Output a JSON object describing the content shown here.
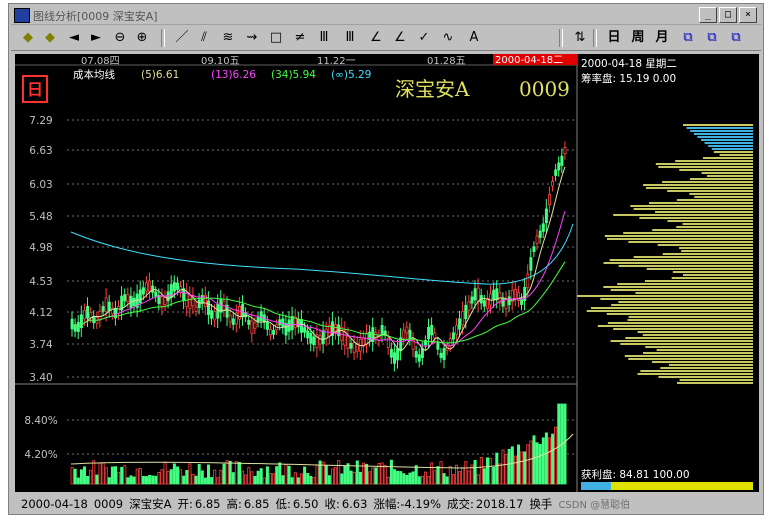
{
  "window": {
    "title": "图线分析[0009 深宝安A]",
    "controls": {
      "minimize": "_",
      "maximize": "□",
      "close": "×"
    }
  },
  "toolbar": {
    "left_tools": [
      "◆",
      "◆",
      "◄",
      "►",
      "⊖",
      "⊕"
    ],
    "draw_tools": [
      "／",
      "⫽",
      "≋",
      "⇝",
      "□",
      "≠",
      "Ⅲ",
      "Ⅲ",
      "∠",
      "∠",
      "✓",
      "∿",
      "A"
    ],
    "period_tools": [
      "日",
      "周",
      "月"
    ]
  },
  "chart_header": {
    "period_badge": "日",
    "indicator_name": "成本均线",
    "ma_values": [
      "(5)6.61",
      "(13)6.26",
      "(34)5.94",
      "(∞)5.29"
    ],
    "ma_colors": [
      "#e0e0a0",
      "#ff40ff",
      "#40ff40",
      "#40e0ff"
    ],
    "stock_title": "深宝安A",
    "stock_code": "0009",
    "date_marks": [
      "07.08四",
      "09.10五",
      "11.22一",
      "01.28五"
    ],
    "cursor_date": "2000-04-18二"
  },
  "price_axis": {
    "ticks": [
      "7.29",
      "6.63",
      "6.03",
      "5.48",
      "4.98",
      "4.53",
      "4.12",
      "3.74",
      "3.40"
    ],
    "volume_ticks": [
      "8.40%",
      "4.20%"
    ]
  },
  "side_panel": {
    "date_line": "2000-04-18 星期二",
    "cost_line": "筹率盘: 15.19 0.00",
    "profit_line": "获利盘: 84.81 100.00"
  },
  "status_bar": {
    "date": "2000-04-18",
    "code": "0009",
    "name": "深宝安A",
    "open_label": "开:",
    "open": "6.85",
    "high_label": "高:",
    "high": "6.85",
    "low_label": "低:",
    "low": "6.50",
    "close_label": "收:",
    "close": "6.63",
    "change_label": "涨幅:",
    "change": "-4.19%",
    "volume_label": "成交:",
    "volume": "2018.17",
    "turnover_label": "换手",
    "watermark": "CSDN @慧聪伯"
  },
  "colors": {
    "background": "#000000",
    "grid": "#808080",
    "up": "#ff4040",
    "down": "#40ff80",
    "axis_text": "#c0c0c0",
    "title_text": "#e0e060",
    "chips_blue": "#40b0e0",
    "chips_yellow": "#c8c860"
  }
}
